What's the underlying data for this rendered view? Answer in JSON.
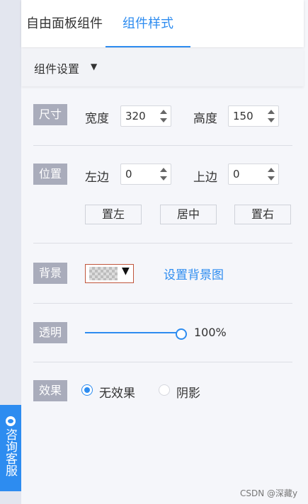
{
  "tabs": [
    "自由面板组件",
    "组件样式"
  ],
  "active_tab": "组件样式",
  "section": {
    "title": "组件设置"
  },
  "size": {
    "tag": "尺寸",
    "width_label": "宽度",
    "width_value": "320",
    "height_label": "高度",
    "height_value": "150"
  },
  "position": {
    "tag": "位置",
    "left_label": "左边",
    "left_value": "0",
    "top_label": "上边",
    "top_value": "0",
    "buttons": [
      "置左",
      "居中",
      "置右"
    ]
  },
  "background": {
    "tag": "背景",
    "link_label": "设置背景图"
  },
  "opacity": {
    "tag": "透明",
    "value": "100%",
    "level": 1.0
  },
  "effect": {
    "tag": "效果",
    "options": [
      "无效果",
      "阴影"
    ],
    "selected": "无效果"
  },
  "side_button": {
    "label": "咨询客服"
  },
  "watermark": "CSDN @深藏y",
  "colors": {
    "accent": "#2d8cf0",
    "tag_bg": "#a9acbb",
    "panel_bg": "#f5f6fa"
  }
}
